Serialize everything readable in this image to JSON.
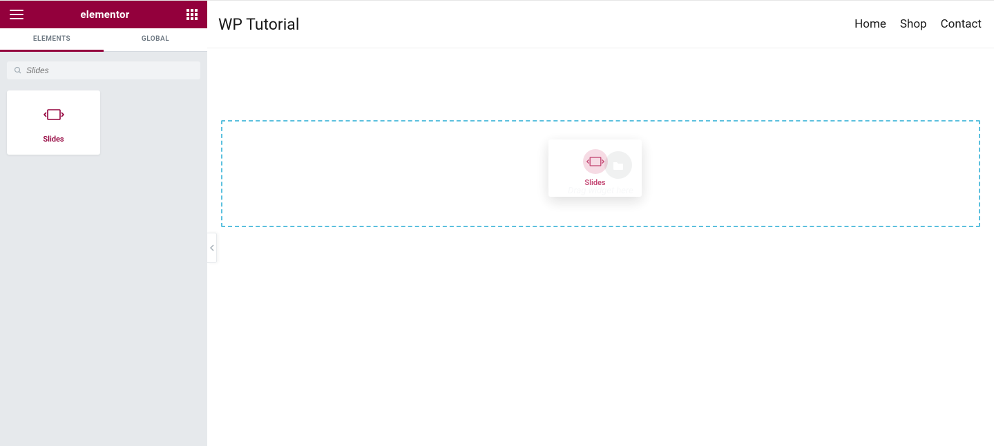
{
  "brand": {
    "name": "elementor",
    "accent": "#93003c"
  },
  "sidebar": {
    "tabs": [
      {
        "label": "ELEMENTS",
        "active": true
      },
      {
        "label": "GLOBAL",
        "active": false
      }
    ],
    "search_placeholder": "Slides",
    "widgets": [
      {
        "label": "Slides",
        "icon": "slides-icon"
      }
    ]
  },
  "site": {
    "title": "WP Tutorial",
    "nav": [
      {
        "label": "Home"
      },
      {
        "label": "Shop"
      },
      {
        "label": "Contact"
      }
    ]
  },
  "dropzone": {
    "hint": "Drag widget here",
    "border_color": "#5bc0de"
  },
  "drag_ghost": {
    "label": "Slides"
  }
}
